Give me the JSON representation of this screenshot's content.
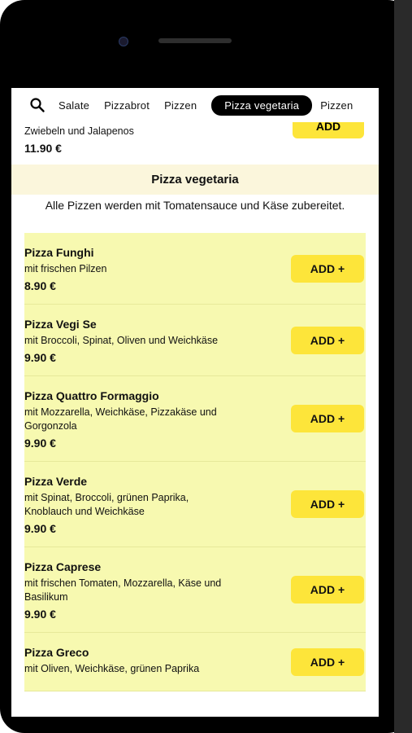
{
  "nav": {
    "tabs": [
      "Salate",
      "Pizzabrot",
      "Pizzen",
      "Pizza vegetaria",
      "Pizzen"
    ],
    "active_index": 3
  },
  "previous_item": {
    "description": "Zwiebeln und Jalapenos",
    "price": "11.90 €",
    "add_label": "ADD"
  },
  "category": {
    "title": "Pizza vegetaria",
    "note": "Alle Pizzen werden mit Tomatensauce und Käse zubereitet."
  },
  "items": [
    {
      "name": "Pizza Funghi",
      "description": "mit frischen Pilzen",
      "price": "8.90 €",
      "add_label": "ADD +"
    },
    {
      "name": "Pizza Vegi Se",
      "description": "mit Broccoli, Spinat, Oliven und Weichkäse",
      "price": "9.90 €",
      "add_label": "ADD +"
    },
    {
      "name": "Pizza Quattro Formaggio",
      "description": "mit Mozzarella, Weichkäse, Pizzakäse und Gorgonzola",
      "price": "9.90 €",
      "add_label": "ADD +"
    },
    {
      "name": "Pizza Verde",
      "description": "mit Spinat, Broccoli, grünen Paprika, Knoblauch und Weichkäse",
      "price": "9.90 €",
      "add_label": "ADD +"
    },
    {
      "name": "Pizza Caprese",
      "description": "mit frischen Tomaten, Mozzarella, Käse und Basilikum",
      "price": "9.90 €",
      "add_label": "ADD +"
    },
    {
      "name": "Pizza Greco",
      "description": "mit Oliven, Weichkäse, grünen Paprika",
      "price": "",
      "add_label": "ADD +"
    }
  ],
  "colors": {
    "accent_yellow": "#fde53a",
    "item_background": "#f7f9b0",
    "category_background": "#fbf6dc"
  }
}
